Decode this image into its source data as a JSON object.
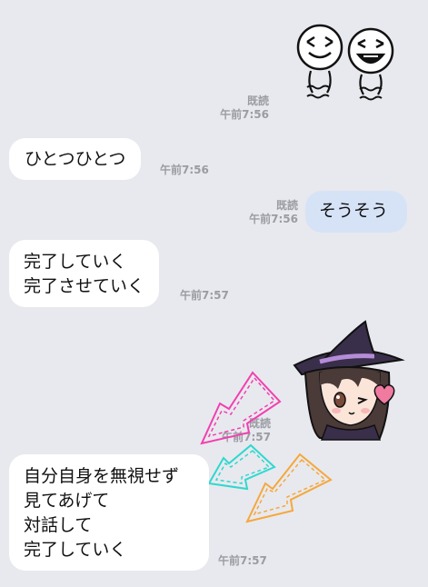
{
  "messages": [
    {
      "kind": "sticker",
      "side": "right",
      "sticker": "smiley-pair-sticker",
      "read": "既読",
      "time": "午前7:56"
    },
    {
      "kind": "text",
      "side": "left",
      "text": "ひとつひとつ",
      "time": "午前7:56"
    },
    {
      "kind": "text",
      "side": "right",
      "text": "そうそう",
      "read": "既読",
      "time": "午前7:56"
    },
    {
      "kind": "text",
      "side": "left",
      "text": "完了していく\n完了させていく",
      "time": "午前7:57"
    },
    {
      "kind": "sticker",
      "side": "right",
      "sticker": "witch-girl-sticker",
      "read": "既読",
      "time": "午前7:57"
    },
    {
      "kind": "text",
      "side": "left",
      "text": "自分自身を無視せず\n見てあげて\n対話して\n完了していく",
      "time": "午前7:57"
    }
  ],
  "colors": {
    "background": "#e8e9ee",
    "incoming_bubble": "#ffffff",
    "outgoing_bubble": "#d6e3f7",
    "meta_text": "#9a9ca3",
    "arrow_pink": "#f23fb0",
    "arrow_cyan": "#2fd8d0",
    "arrow_orange": "#f4a83c"
  },
  "icons": [
    "smiley-pair-sticker",
    "witch-girl-sticker",
    "heart-icon",
    "arrow-pink-icon",
    "arrow-cyan-icon",
    "arrow-orange-icon"
  ]
}
